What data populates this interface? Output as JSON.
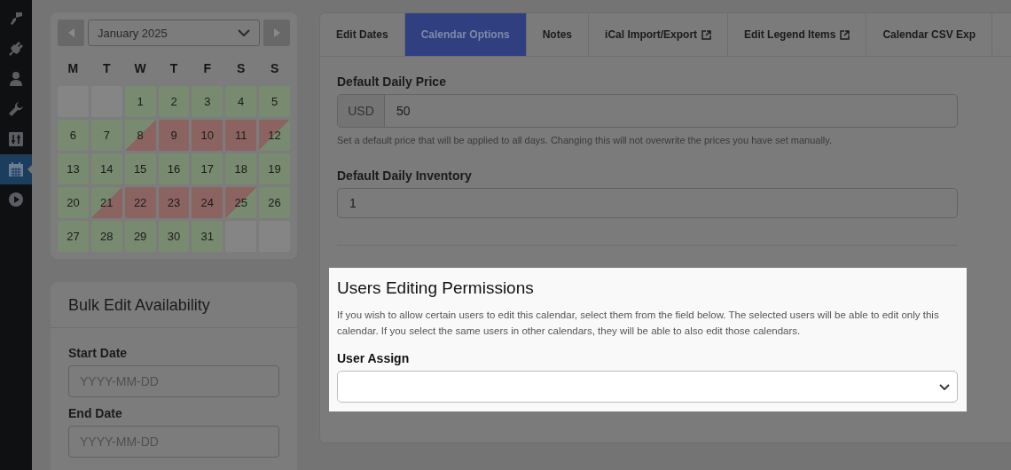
{
  "sidebar": {
    "items": [
      {
        "selected": false
      },
      {
        "selected": false
      },
      {
        "selected": false
      },
      {
        "selected": false
      },
      {
        "selected": false
      },
      {
        "selected": true
      },
      {
        "selected": false
      }
    ]
  },
  "calendar": {
    "month": "January 2025",
    "weekdays": [
      "M",
      "T",
      "W",
      "T",
      "F",
      "S",
      "S"
    ],
    "days": [
      {
        "kind": "empty"
      },
      {
        "kind": "empty"
      },
      {
        "label": "1",
        "kind": "available"
      },
      {
        "label": "2",
        "kind": "available"
      },
      {
        "label": "3",
        "kind": "available"
      },
      {
        "label": "4",
        "kind": "available"
      },
      {
        "label": "5",
        "kind": "available"
      },
      {
        "label": "6",
        "kind": "available"
      },
      {
        "label": "7",
        "kind": "available"
      },
      {
        "label": "8",
        "kind": "check_in"
      },
      {
        "label": "9",
        "kind": "booked"
      },
      {
        "label": "10",
        "kind": "booked"
      },
      {
        "label": "11",
        "kind": "booked"
      },
      {
        "label": "12",
        "kind": "check_out"
      },
      {
        "label": "13",
        "kind": "available"
      },
      {
        "label": "14",
        "kind": "available"
      },
      {
        "label": "15",
        "kind": "available"
      },
      {
        "label": "16",
        "kind": "available"
      },
      {
        "label": "17",
        "kind": "available"
      },
      {
        "label": "18",
        "kind": "available"
      },
      {
        "label": "19",
        "kind": "available"
      },
      {
        "label": "20",
        "kind": "available"
      },
      {
        "label": "21",
        "kind": "check_in"
      },
      {
        "label": "22",
        "kind": "booked"
      },
      {
        "label": "23",
        "kind": "booked"
      },
      {
        "label": "24",
        "kind": "booked"
      },
      {
        "label": "25",
        "kind": "check_out"
      },
      {
        "label": "26",
        "kind": "available"
      },
      {
        "label": "27",
        "kind": "available"
      },
      {
        "label": "28",
        "kind": "available"
      },
      {
        "label": "29",
        "kind": "available"
      },
      {
        "label": "30",
        "kind": "available"
      },
      {
        "label": "31",
        "kind": "available"
      },
      {
        "kind": "empty"
      },
      {
        "kind": "empty"
      }
    ]
  },
  "bulk_edit": {
    "title": "Bulk Edit Availability",
    "fields": [
      {
        "label": "Start Date",
        "placeholder": "YYYY-MM-DD"
      },
      {
        "label": "End Date",
        "placeholder": "YYYY-MM-DD"
      }
    ]
  },
  "tabs": [
    {
      "label": "Edit Dates",
      "selected": false,
      "external": false
    },
    {
      "label": "Calendar Options",
      "selected": true,
      "external": false
    },
    {
      "label": "Notes",
      "selected": false,
      "external": false
    },
    {
      "label": "iCal Import/Export",
      "selected": false,
      "external": true
    },
    {
      "label": "Edit Legend Items",
      "selected": false,
      "external": true
    },
    {
      "label": "Calendar CSV Exp",
      "selected": false,
      "external": false
    }
  ],
  "price": {
    "label": "Default Daily Price",
    "currency": "USD",
    "value": "50",
    "help": "Set a default price that will be applied to all days. Changing this will not overwrite the prices you have set manually."
  },
  "inventory": {
    "label": "Default Daily Inventory",
    "value": "1"
  },
  "permissions": {
    "title": "Users Editing Permissions",
    "description": "If you wish to allow certain users to edit this calendar, select them from the field below. The selected users will be able to edit only this calendar. If you select the same users in other calendars, they will be able to also edit those calendars.",
    "field_label": "User Assign"
  }
}
